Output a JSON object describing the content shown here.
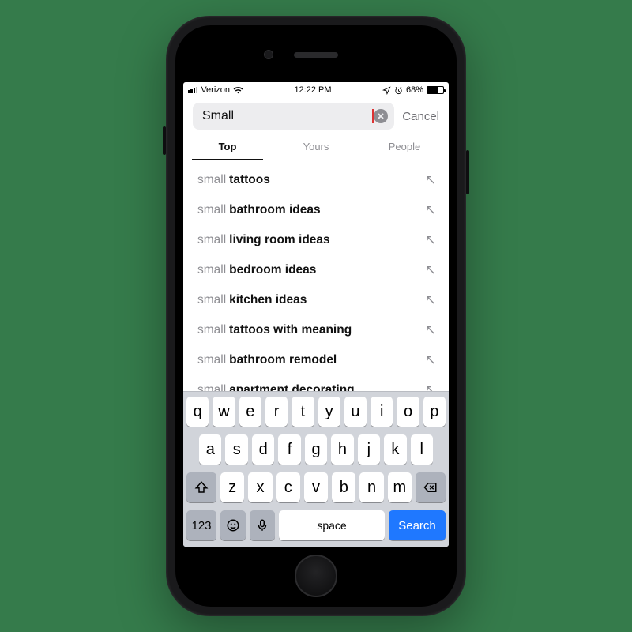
{
  "status": {
    "carrier": "Verizon",
    "time": "12:22 PM",
    "battery_pct": "68%"
  },
  "search": {
    "query": "Small",
    "cancel": "Cancel"
  },
  "tabs": [
    "Top",
    "Yours",
    "People"
  ],
  "suggestions": [
    {
      "prefix": "small",
      "completion": "tattoos"
    },
    {
      "prefix": "small",
      "completion": "bathroom ideas"
    },
    {
      "prefix": "small",
      "completion": "living room ideas"
    },
    {
      "prefix": "small",
      "completion": "bedroom ideas"
    },
    {
      "prefix": "small",
      "completion": "kitchen ideas"
    },
    {
      "prefix": "small",
      "completion": "tattoos with meaning"
    },
    {
      "prefix": "small",
      "completion": "bathroom remodel"
    },
    {
      "prefix": "small",
      "completion": "apartment decorating"
    }
  ],
  "keyboard": {
    "row1": [
      "q",
      "w",
      "e",
      "r",
      "t",
      "y",
      "u",
      "i",
      "o",
      "p"
    ],
    "row2": [
      "a",
      "s",
      "d",
      "f",
      "g",
      "h",
      "j",
      "k",
      "l"
    ],
    "row3": [
      "z",
      "x",
      "c",
      "v",
      "b",
      "n",
      "m"
    ],
    "numk": "123",
    "space": "space",
    "search": "Search"
  }
}
